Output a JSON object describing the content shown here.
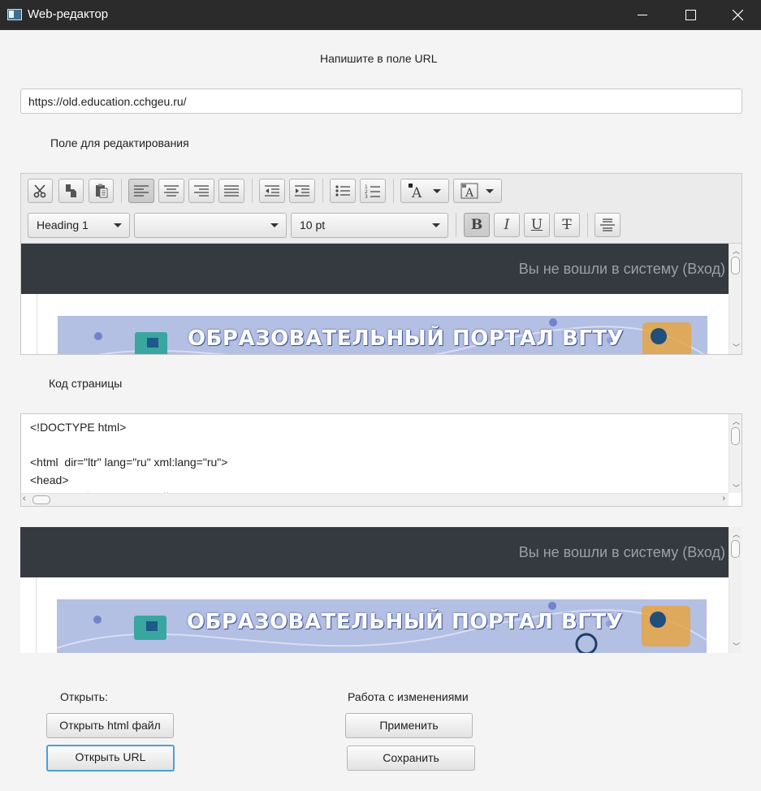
{
  "window": {
    "title": "Web-редактор"
  },
  "url_prompt": "Напишите в поле URL",
  "url_value": "https://old.education.cchgeu.ru/",
  "edit_label": "Поле для редактирования",
  "editor": {
    "paragraph_style": "Heading 1",
    "font_family": "",
    "font_size": "10 pt",
    "webview": {
      "login_text": "Вы не вошли в систему (Вход)",
      "banner_text": "ОБРАЗОВАТЕЛЬНЫЙ ПОРТАЛ ВГТУ"
    }
  },
  "code_label": "Код страницы",
  "code_lines": [
    "<!DOCTYPE html>",
    "",
    "<html  dir=\"ltr\" lang=\"ru\" xml:lang=\"ru\">",
    "<head>",
    "    <title>Образовательный портал ВГТУ</title>"
  ],
  "preview": {
    "login_text": "Вы не вошли в систему (Вход)",
    "banner_text": "ОБРАЗОВАТЕЛЬНЫЙ ПОРТАЛ ВГТУ"
  },
  "open_section": {
    "label": "Открыть:",
    "open_html_button": "Открыть html файл",
    "open_url_button": "Открыть URL"
  },
  "changes_section": {
    "label": "Работа с изменениями",
    "apply_button": "Применить",
    "save_button": "Сохранить"
  },
  "colors": {
    "titlebar": "#2b2b2b",
    "webpage_header": "#343a40",
    "banner": "#b3bfe3",
    "focus_border": "#4aa0d8"
  }
}
